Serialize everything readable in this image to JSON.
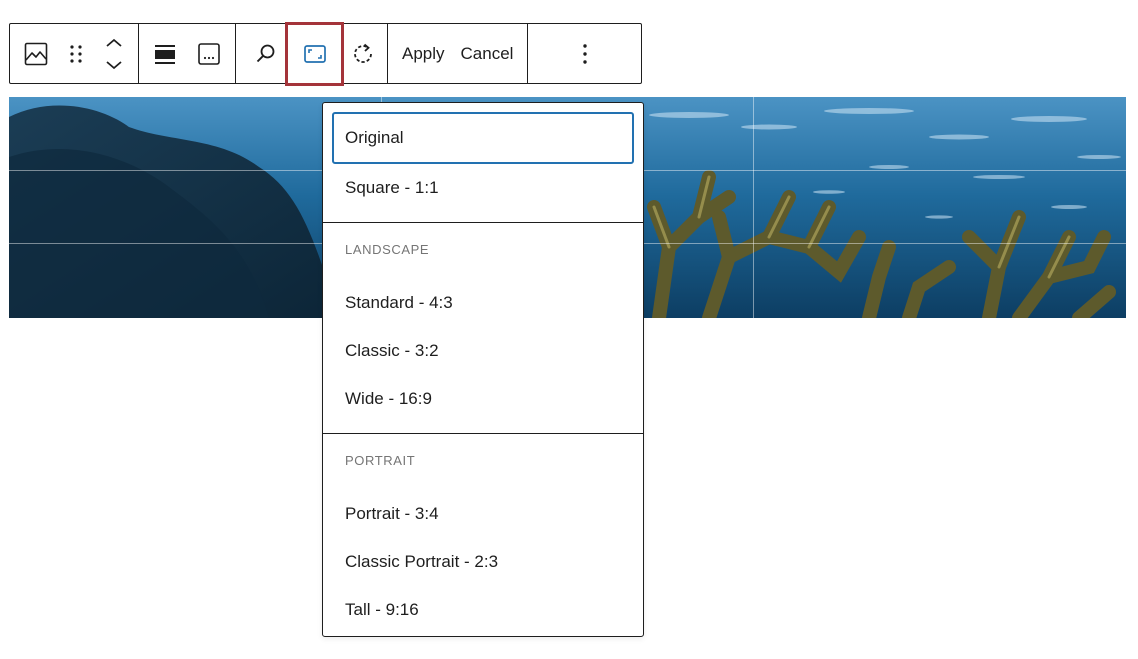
{
  "toolbar": {
    "apply_label": "Apply",
    "cancel_label": "Cancel",
    "buttons": [
      {
        "icon": "image-icon"
      },
      {
        "icon": "drag-handle-icon"
      },
      {
        "icon": "move-up-down-icon"
      },
      {
        "icon": "align-full-icon"
      },
      {
        "icon": "caption-icon"
      },
      {
        "icon": "zoom-icon"
      },
      {
        "icon": "aspect-ratio-icon"
      },
      {
        "icon": "rotate-icon"
      },
      {
        "icon": "more-options-icon"
      }
    ],
    "accent_color": "#2271b1",
    "highlight_color": "#a4343a"
  },
  "aspect_menu": {
    "items_top": [
      {
        "label": "Original",
        "selected": true
      },
      {
        "label": "Square - 1:1"
      }
    ],
    "landscape_heading": "LANDSCAPE",
    "landscape_items": [
      {
        "label": "Standard - 4:3"
      },
      {
        "label": "Classic - 3:2"
      },
      {
        "label": "Wide - 16:9"
      }
    ],
    "portrait_heading": "PORTRAIT",
    "portrait_items": [
      {
        "label": "Portrait - 3:4"
      },
      {
        "label": "Classic Portrait - 2:3"
      },
      {
        "label": "Tall - 9:16"
      }
    ]
  }
}
